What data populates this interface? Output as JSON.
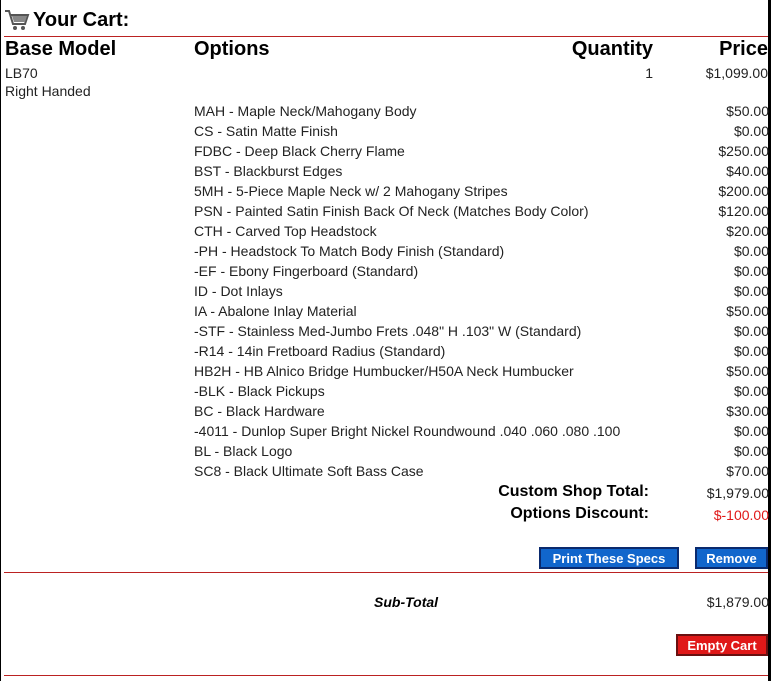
{
  "header": {
    "title": "Your Cart:"
  },
  "columns": {
    "base_model": "Base Model",
    "options": "Options",
    "quantity": "Quantity",
    "price": "Price"
  },
  "item": {
    "model": "LB70",
    "handedness": "Right Handed",
    "quantity": "1",
    "price": "$1,099.00"
  },
  "options": [
    {
      "name": "MAH - Maple Neck/Mahogany Body",
      "price": "$50.00"
    },
    {
      "name": "CS - Satin Matte Finish",
      "price": "$0.00"
    },
    {
      "name": "FDBC - Deep Black Cherry Flame",
      "price": "$250.00"
    },
    {
      "name": "BST - Blackburst Edges",
      "price": "$40.00"
    },
    {
      "name": "5MH - 5-Piece Maple Neck w/ 2 Mahogany Stripes",
      "price": "$200.00"
    },
    {
      "name": "PSN - Painted Satin Finish Back Of Neck (Matches Body Color)",
      "price": "$120.00"
    },
    {
      "name": "CTH - Carved Top Headstock",
      "price": "$20.00"
    },
    {
      "name": "-PH - Headstock To Match Body Finish (Standard)",
      "price": "$0.00"
    },
    {
      "name": "-EF - Ebony Fingerboard (Standard)",
      "price": "$0.00"
    },
    {
      "name": "ID - Dot Inlays",
      "price": "$0.00"
    },
    {
      "name": "IA - Abalone Inlay Material",
      "price": "$50.00"
    },
    {
      "name": "-STF - Stainless Med-Jumbo Frets .048\" H .103\" W (Standard)",
      "price": "$0.00"
    },
    {
      "name": "-R14 - 14in Fretboard Radius (Standard)",
      "price": "$0.00"
    },
    {
      "name": "HB2H - HB Alnico Bridge Humbucker/H50A Neck Humbucker",
      "price": "$50.00"
    },
    {
      "name": "-BLK - Black Pickups",
      "price": "$0.00"
    },
    {
      "name": "BC - Black Hardware",
      "price": "$30.00"
    },
    {
      "name": "-4011 - Dunlop Super Bright Nickel Roundwound .040 .060 .080 .100",
      "price": "$0.00"
    },
    {
      "name": "BL - Black Logo",
      "price": "$0.00"
    },
    {
      "name": "SC8 - Black Ultimate Soft Bass Case",
      "price": "$70.00"
    }
  ],
  "summary": {
    "custom_shop_label": "Custom Shop Total:",
    "custom_shop_value": "$1,979.00",
    "discount_label": "Options Discount:",
    "discount_value": "$-100.00",
    "discount_color": "#e01818"
  },
  "buttons": {
    "print_specs": "Print These Specs",
    "remove": "Remove",
    "empty_cart": "Empty Cart"
  },
  "subtotal": {
    "label": "Sub-Total",
    "value": "$1,879.00"
  },
  "icons": {
    "cart": "shopping-cart-icon"
  },
  "colors": {
    "rule": "#b22222",
    "button_blue": "#1166cc",
    "button_red": "#e01818"
  }
}
